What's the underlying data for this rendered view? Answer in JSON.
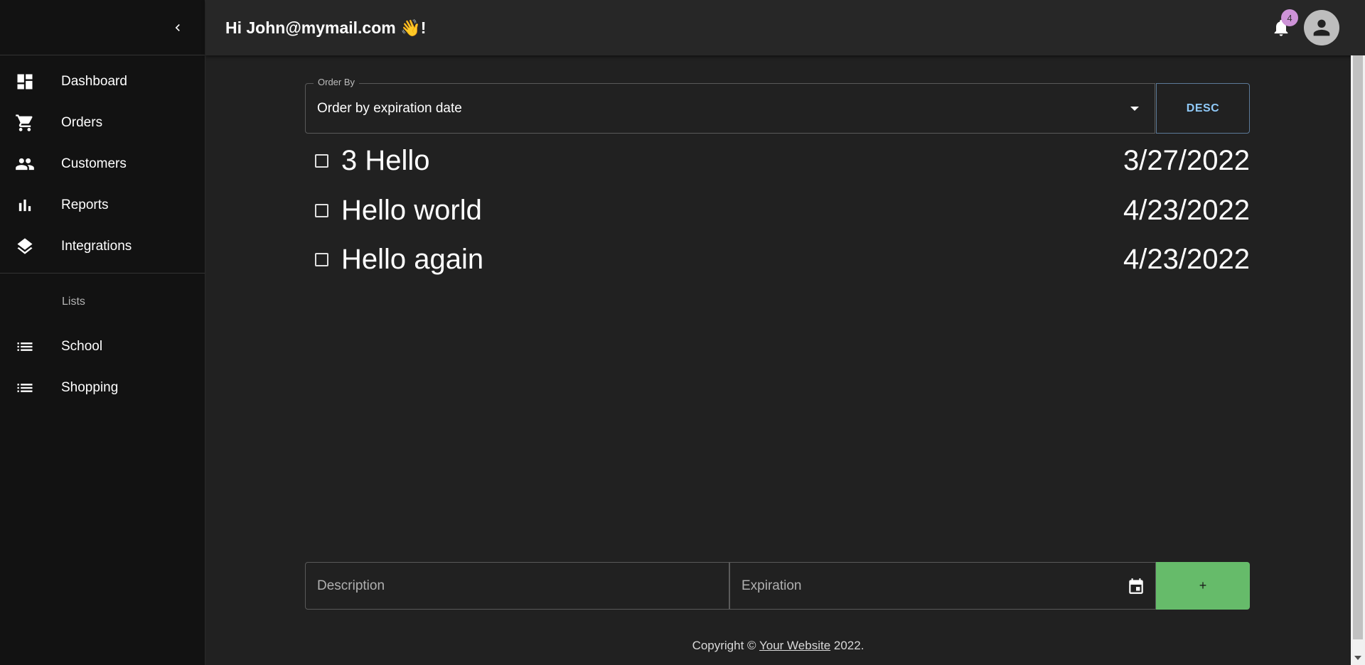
{
  "sidebar": {
    "main_items": [
      {
        "label": "Dashboard",
        "icon": "dashboard-icon"
      },
      {
        "label": "Orders",
        "icon": "cart-icon"
      },
      {
        "label": "Customers",
        "icon": "people-icon"
      },
      {
        "label": "Reports",
        "icon": "bar-chart-icon"
      },
      {
        "label": "Integrations",
        "icon": "layers-icon"
      }
    ],
    "lists_header": "Lists",
    "list_items": [
      {
        "label": "School",
        "icon": "list-icon"
      },
      {
        "label": "Shopping",
        "icon": "list-icon"
      }
    ]
  },
  "header": {
    "greeting": "Hi John@mymail.com 👋!",
    "notification_count": "4"
  },
  "main": {
    "order_by": {
      "legend": "Order By",
      "value": "Order by expiration date",
      "direction_label": "DESC"
    },
    "todos": [
      {
        "text": "3 Hello",
        "date": "3/27/2022",
        "checked": false
      },
      {
        "text": "Hello world",
        "date": "4/23/2022",
        "checked": false
      },
      {
        "text": "Hello again",
        "date": "4/23/2022",
        "checked": false
      }
    ],
    "form": {
      "description_placeholder": "Description",
      "expiration_placeholder": "Expiration",
      "add_label": "+"
    }
  },
  "footer": {
    "prefix": "Copyright © ",
    "link_text": "Your Website",
    "suffix": " 2022."
  },
  "colors": {
    "background": "#212121",
    "sidebar": "#121212",
    "header": "#272727",
    "accent_blue": "#90caf9",
    "add_button": "#66bb6a",
    "badge": "#ce93d8"
  }
}
